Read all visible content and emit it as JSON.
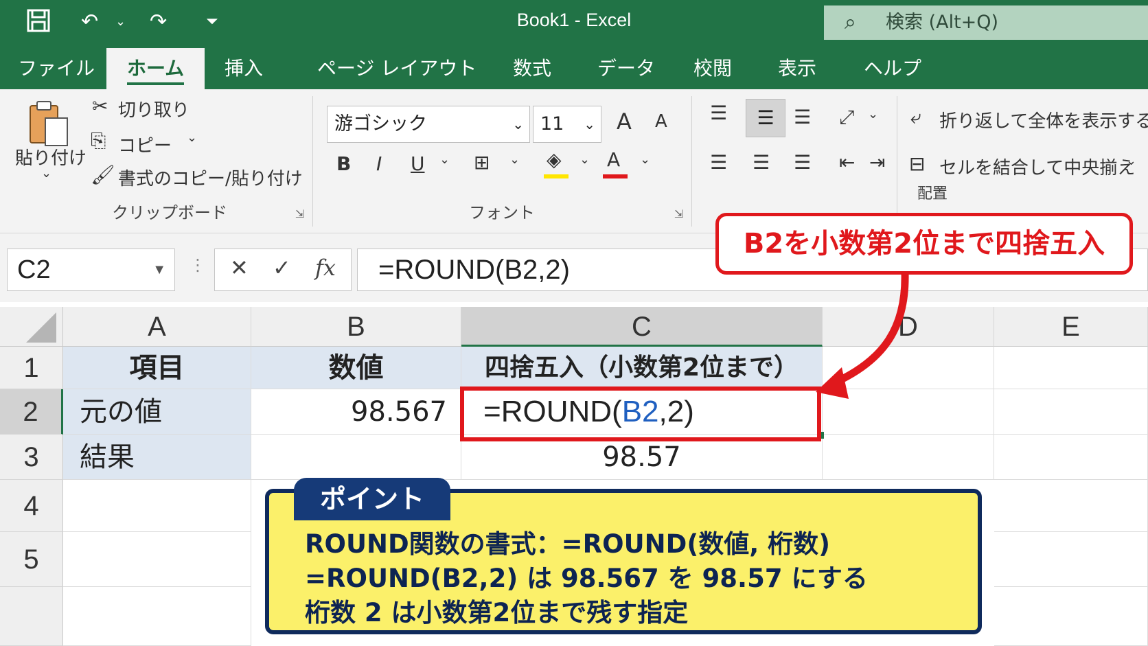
{
  "app": {
    "title": "Book1  -  Excel",
    "search_placeholder": "検索 (Alt+Q)"
  },
  "tabs": [
    "ファイル",
    "ホーム",
    "挿入",
    "ページ レイアウト",
    "数式",
    "データ",
    "校閲",
    "表示",
    "ヘルプ"
  ],
  "active_tab": "ホーム",
  "ribbon": {
    "paste_label": "貼り付け",
    "cut_label": "切り取り",
    "copy_label": "コピー",
    "format_painter_label": "書式のコピー/貼り付け",
    "clipboard_group": "クリップボード",
    "font_name": "游ゴシック",
    "font_size": "11",
    "font_group": "フォント",
    "wrap_text_label": "折り返して全体を表示する",
    "merge_center_label": "セルを結合して中央揃え",
    "alignment_group": "配置",
    "bold_glyph": "B",
    "italic_glyph": "I",
    "underline_glyph": "U",
    "grow_font_glyph": "A",
    "shrink_font_glyph": "A",
    "font_color_glyph": "A",
    "highlight_color": "#ffe600",
    "font_color": "#e0181c"
  },
  "formula_bar": {
    "name_box": "C2",
    "cancel_glyph": "✕",
    "enter_glyph": "✓",
    "fx_glyph": "fx",
    "formula": "=ROUND(B2,2)"
  },
  "columns": [
    "A",
    "B",
    "C",
    "D",
    "E"
  ],
  "rows": [
    "1",
    "2",
    "3",
    "4",
    "5"
  ],
  "cells": {
    "A1": "項目",
    "B1": "数値",
    "C1": "四捨五入（小数第2位まで）",
    "A2": "元の値",
    "B2": "98.567",
    "C2_prefix": "=ROUND(",
    "C2_ref": "B2",
    "C2_suffix": ",2)",
    "A3": "結果",
    "C3": "98.57"
  },
  "annotation": {
    "callout": "B2を小数第2位まで四捨五入",
    "point_title": "ポイント",
    "point_lines": [
      "ROUND関数の書式：=ROUND(数値, 桁数)",
      "=ROUND(B2,2) は 98.567 を 98.57 にする",
      "桁数 2 は小数第2位まで残す指定"
    ]
  },
  "colors": {
    "excel_green": "#217346",
    "accent_red": "#e0181c",
    "ref_blue": "#1f5fc0",
    "header_blue": "#dde6f1",
    "point_yellow": "#fbf06a",
    "point_navy": "#163a78"
  }
}
